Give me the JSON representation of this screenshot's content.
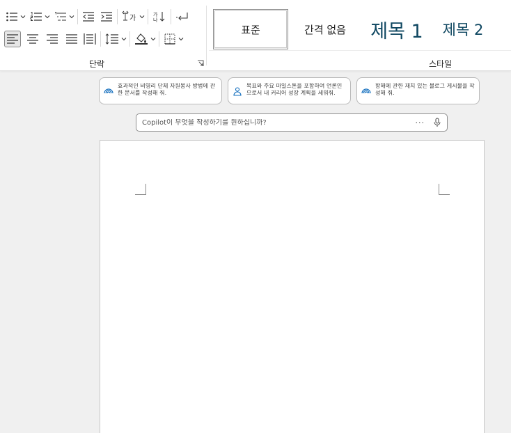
{
  "ribbon": {
    "paragraph_group": {
      "label": "단락",
      "row1": [
        "bullets-icon",
        "numbering-icon",
        "multilevel-list-icon",
        "decrease-indent-icon",
        "increase-indent-icon",
        "asian-layout-icon",
        "sort-icon",
        "show-formatting-marks-icon"
      ],
      "row2": [
        "align-left-icon",
        "align-center-icon",
        "align-right-icon",
        "justify-icon",
        "distributed-icon",
        "line-spacing-icon",
        "shading-icon",
        "borders-icon"
      ],
      "active": "align-left-icon"
    },
    "styles_group": {
      "label": "스타일",
      "items": [
        {
          "label": "표준",
          "selected": true
        },
        {
          "label": "간격 없음"
        },
        {
          "label": "제목 1"
        },
        {
          "label": "제목 2"
        }
      ],
      "heading_color": "#0f4761"
    }
  },
  "copilot": {
    "suggestions": [
      {
        "icon": "sparkle-wave-icon",
        "text": "효과적인 비영리 단체 자원봉사 방법에 관한 문서를 작성해 줘."
      },
      {
        "icon": "person-icon",
        "text": "목표와 주요 마일스톤을 포함하여 언론인으로서 내 커리어 성장 계획을 세워줘."
      },
      {
        "icon": "sparkle-wave-icon",
        "text": "항해에 관한 재치 있는 블로그 게시물을 작성해 줘."
      }
    ],
    "prompt": {
      "placeholder": "Copilot이 무엇을 작성하기를 원하십니까?",
      "more": "···"
    }
  }
}
